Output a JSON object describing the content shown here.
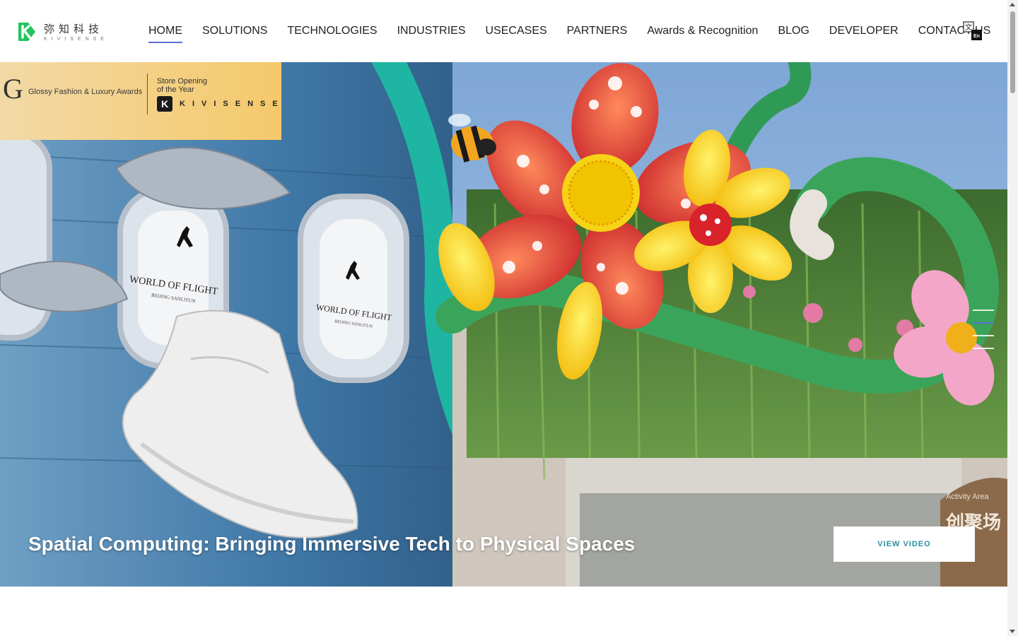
{
  "brand": {
    "name_cn": "弥知科技",
    "name_en": "KIVISENSE",
    "accent": "#21c45d"
  },
  "nav": {
    "items": [
      {
        "label": "HOME",
        "active": true
      },
      {
        "label": "SOLUTIONS"
      },
      {
        "label": "TECHNOLOGIES"
      },
      {
        "label": "INDUSTRIES"
      },
      {
        "label": "USECASES"
      },
      {
        "label": "PARTNERS"
      },
      {
        "label": "Awards & Recognition"
      },
      {
        "label": "BLOG"
      },
      {
        "label": "DEVELOPER"
      },
      {
        "label": "CONTACT US"
      }
    ],
    "active_color": "#5b6fd6",
    "language_icon": "translate-icon",
    "language_glyph": "文",
    "language_code": "En"
  },
  "hero": {
    "award": {
      "logo_letter": "G",
      "name": "Glossy Fashion & Luxury Awards",
      "line1": "Store Opening",
      "line2": "of the Year",
      "brand_mark": "K",
      "brand_text": "KIVISENSE"
    },
    "scene_text": {
      "plaque_title": "WORLD OF FLIGHT",
      "plaque_sub": "BEIJING SANLITUN",
      "storefront_sign": "Activity Area",
      "storefront_cn": "创聚场"
    },
    "title": "Spatial Computing: Bringing Immersive Tech to Physical Spaces",
    "cta_label": "VIEW VIDEO",
    "cta_color": "#2a8fa6",
    "slides": {
      "count": 4,
      "active": 2
    }
  }
}
